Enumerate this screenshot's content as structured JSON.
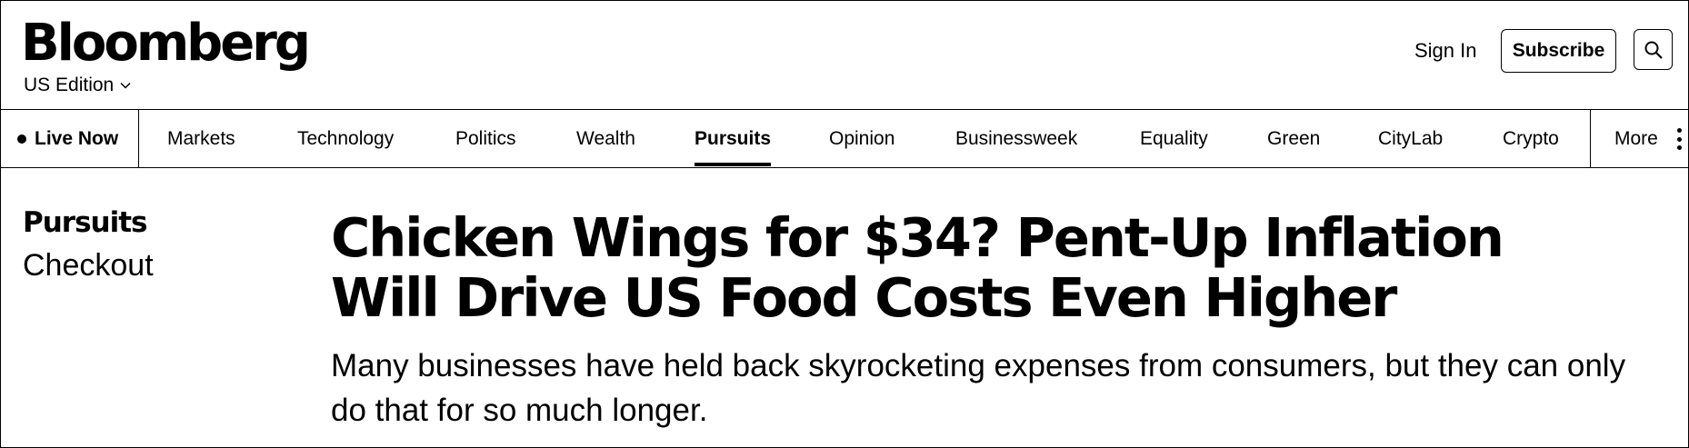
{
  "header": {
    "logo": "Bloomberg",
    "edition": "US Edition",
    "sign_in": "Sign In",
    "subscribe": "Subscribe",
    "search_icon": "search-icon"
  },
  "nav": {
    "live_now": "Live Now",
    "items": [
      "Markets",
      "Technology",
      "Politics",
      "Wealth",
      "Pursuits",
      "Opinion",
      "Businessweek",
      "Equality",
      "Green",
      "CityLab",
      "Crypto"
    ],
    "active": "Pursuits",
    "more": "More"
  },
  "article": {
    "section": "Pursuits",
    "subsection": "Checkout",
    "headline": "Chicken Wings for $34? Pent-Up Inflation Will Drive US Food Costs Even Higher",
    "dek": "Many businesses have held back skyrocketing expenses from consumers, but they can only do that for so much longer."
  }
}
